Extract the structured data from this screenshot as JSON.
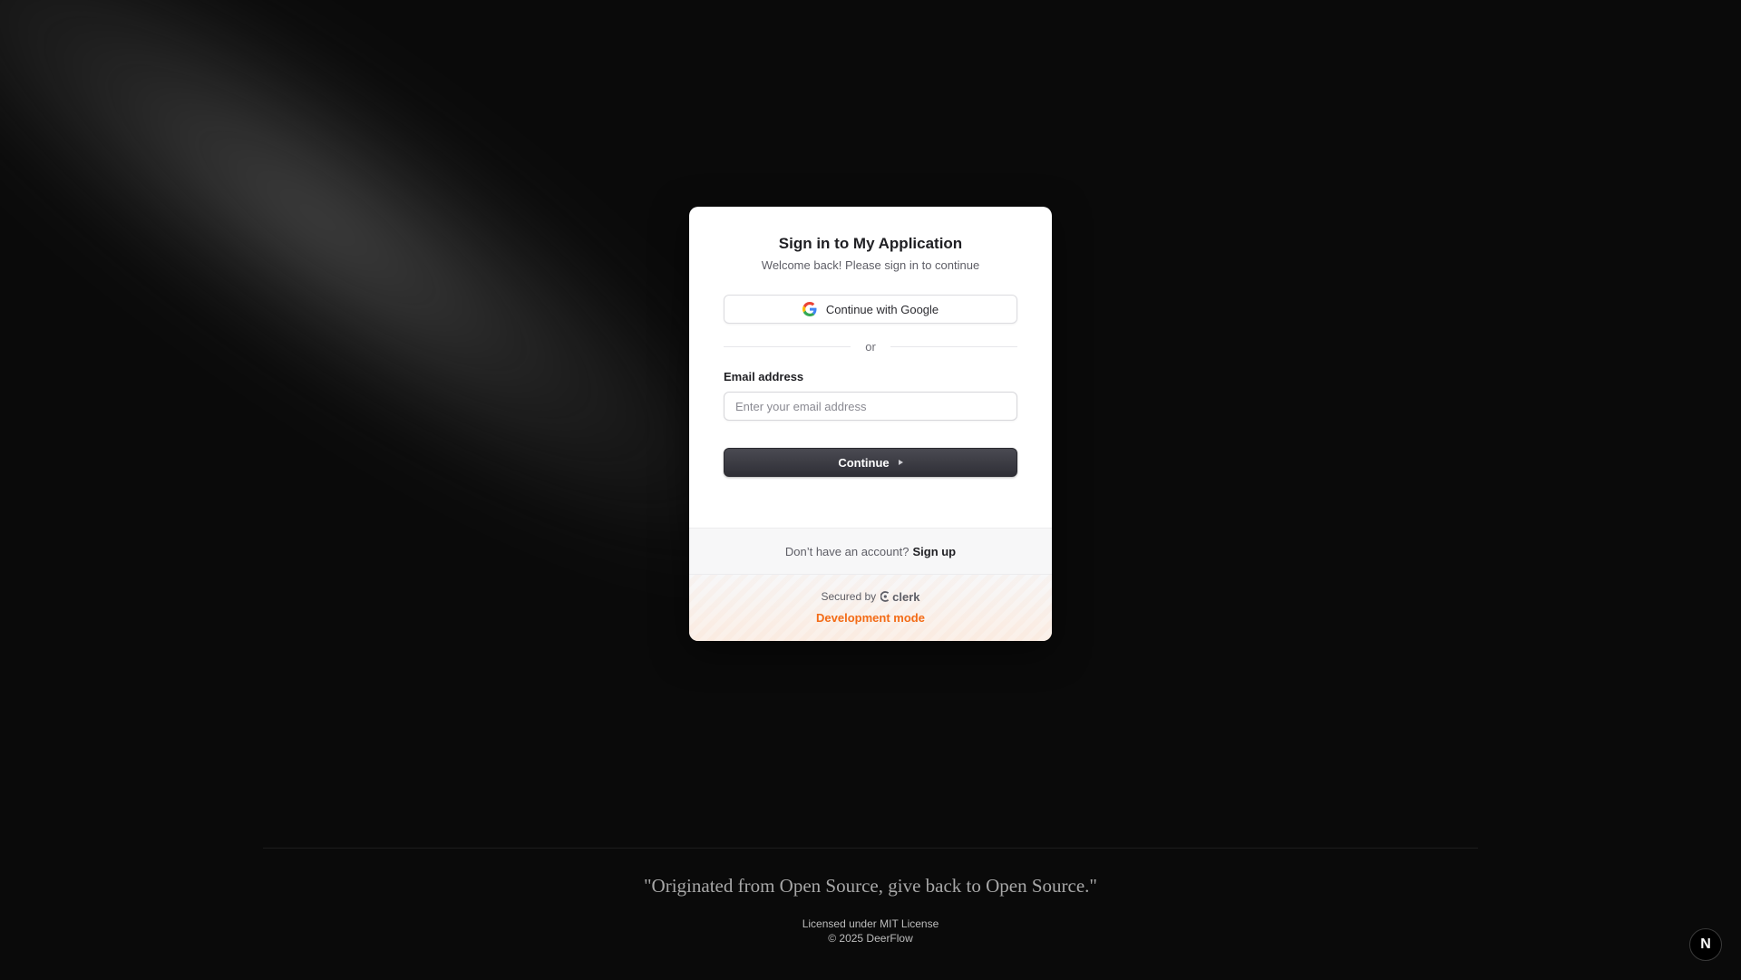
{
  "card": {
    "title": "Sign in to My Application",
    "subtitle": "Welcome back! Please sign in to continue",
    "google_button_label": "Continue with Google",
    "divider_text": "or",
    "email_label": "Email address",
    "email_placeholder": "Enter your email address",
    "email_value": "",
    "continue_label": "Continue",
    "signup_prompt": "Don’t have an account?",
    "signup_link": "Sign up",
    "secured_by": "Secured by",
    "clerk_brand": "clerk",
    "dev_mode": "Development mode"
  },
  "footer": {
    "quote": "\"Originated from Open Source, give back to Open Source.\"",
    "license": "Licensed under MIT License",
    "copyright": "© 2025 DeerFlow"
  },
  "badge": {
    "letter": "N",
    "icon": "nextjs-icon"
  },
  "colors": {
    "background": "#0a0a0a",
    "card": "#ffffff",
    "primary_button": "#3a3a42",
    "dev_mode": "#f36b16"
  }
}
